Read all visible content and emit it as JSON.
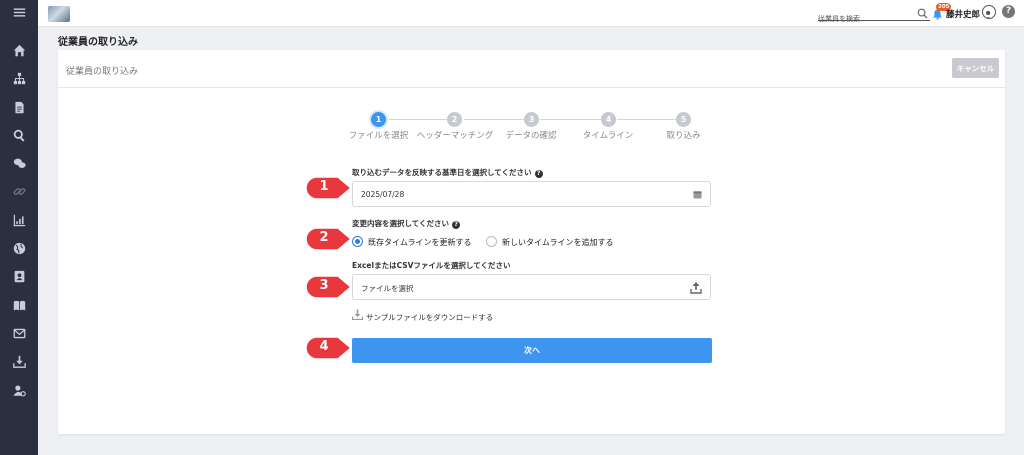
{
  "topbar": {
    "search_placeholder": "従業員を検索",
    "notification_count": "205",
    "user_name": "藤井史郎",
    "help_symbol": "?"
  },
  "page": {
    "title": "従業員の取り込み"
  },
  "card": {
    "title": "従業員の取り込み",
    "cancel_label": "キャンセル"
  },
  "stepper": {
    "steps": [
      {
        "number": "1",
        "label": "ファイルを選択",
        "state": "active"
      },
      {
        "number": "2",
        "label": "ヘッダーマッチング",
        "state": "inactive"
      },
      {
        "number": "3",
        "label": "データの確認",
        "state": "inactive"
      },
      {
        "number": "4",
        "label": "タイムライン",
        "state": "inactive"
      },
      {
        "number": "5",
        "label": "取り込み",
        "state": "inactive"
      }
    ]
  },
  "form": {
    "date_label": "取り込むデータを反映する基準日を選択してください",
    "date_value": "2025/07/28",
    "change_label": "変更内容を選択してください",
    "radio_options": [
      {
        "label": "既存タイムラインを更新する",
        "checked": true
      },
      {
        "label": "新しいタイムラインを追加する",
        "checked": false
      }
    ],
    "file_label": "ExcelまたはCSVファイルを選択してください",
    "file_placeholder": "ファイルを選択",
    "download_link": "サンプルファイルをダウンロードする",
    "next_label": "次へ",
    "info_symbol": "?"
  },
  "callouts": [
    "1",
    "2",
    "3",
    "4"
  ],
  "colors": {
    "sidebar": "#2b3040",
    "primary": "#3d95f0",
    "badge": "#f05a28",
    "callout": "#e8383d"
  },
  "sidebar_icons": [
    "menu-icon",
    "home-icon",
    "org-chart-icon",
    "document-icon",
    "search-icon",
    "chat-icon",
    "link-icon",
    "chart-icon",
    "globe-icon",
    "contact-card-icon",
    "book-icon",
    "mail-icon",
    "download-icon",
    "user-settings-icon"
  ]
}
